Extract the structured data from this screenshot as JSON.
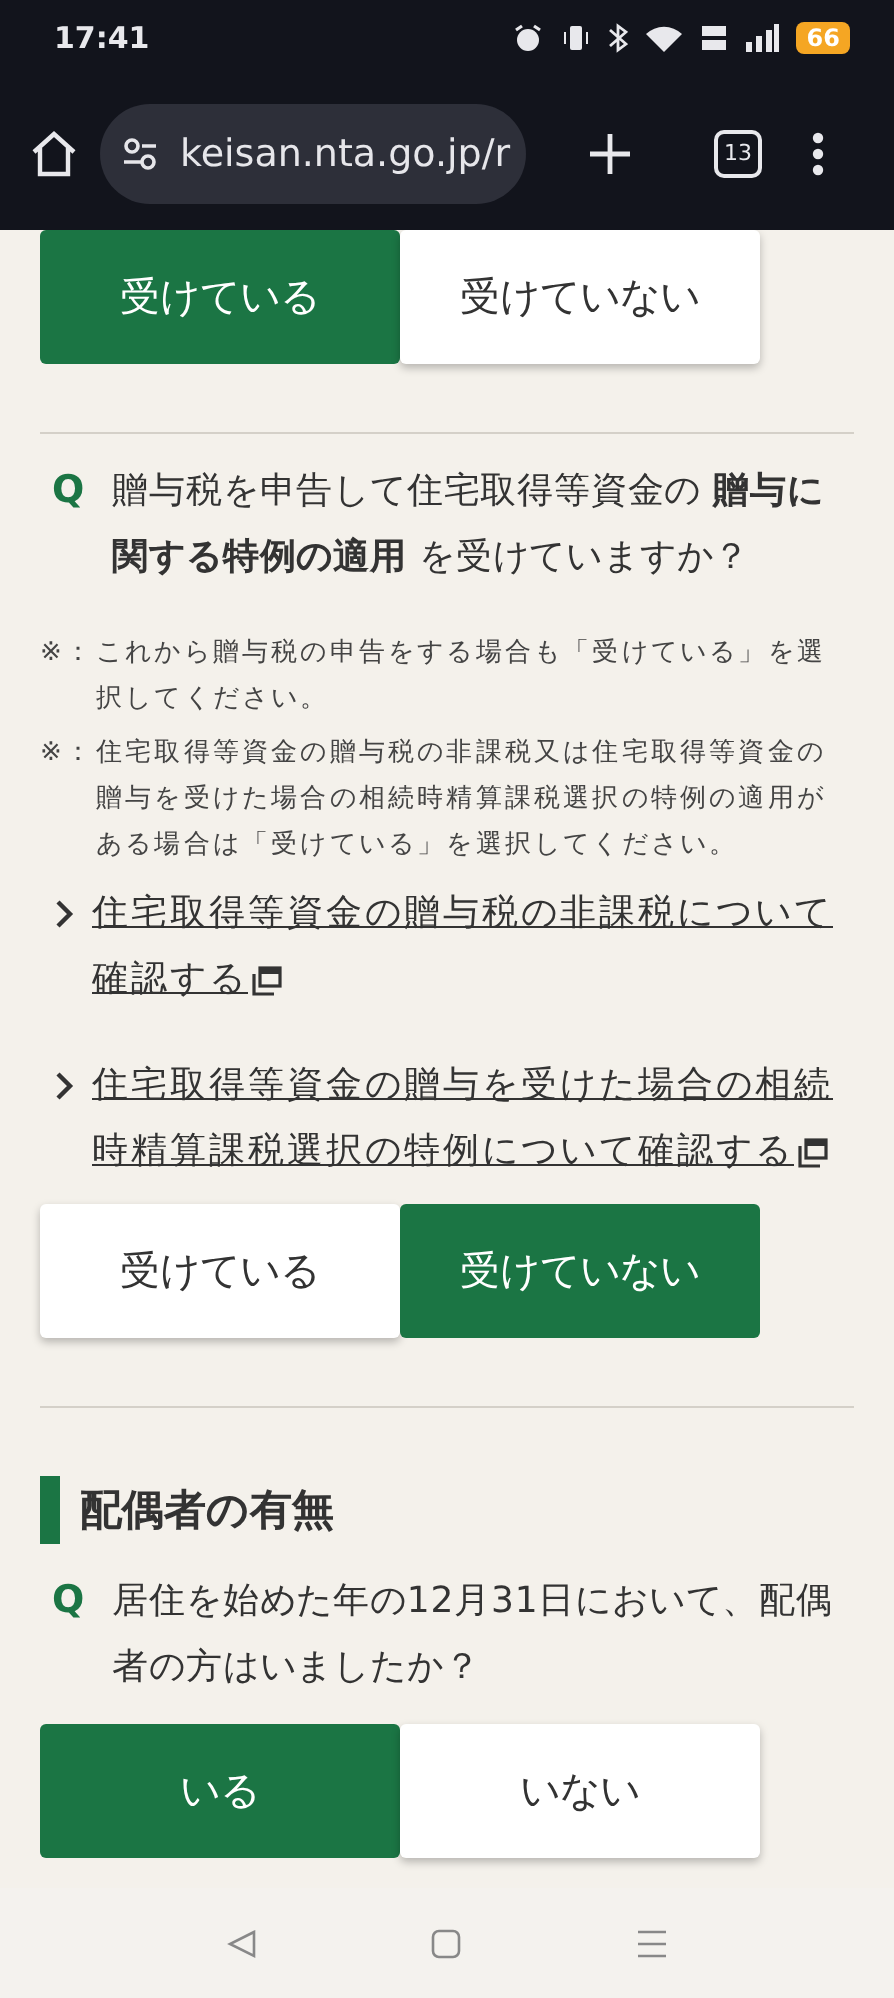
{
  "status_bar": {
    "time": "17:41",
    "battery": "66"
  },
  "browser": {
    "url": "keisan.nta.go.jp/r",
    "tab_count": "13"
  },
  "content": [
    {
      "kind": "choices",
      "options": [
        {
          "label": "受けている",
          "selected": true
        },
        {
          "label": "受けていない",
          "selected": false
        }
      ]
    },
    {
      "kind": "divider"
    },
    {
      "kind": "question",
      "mark": "Q",
      "text": "贈与税を申告して住宅取得等資金の **贈与に関する特例の適用** を受けていますか？"
    },
    {
      "kind": "note",
      "mark": "※：",
      "text": "これから贈与税の申告をする場合も「受けている」を選択してください。"
    },
    {
      "kind": "note",
      "mark": "※：",
      "text": "住宅取得等資金の贈与税の非課税又は住宅取得等資金の贈与を受けた場合の相続時精算課税選択の特例の適用がある場合は「受けている」を選択してください。"
    },
    {
      "kind": "link",
      "text": "住宅取得等資金の贈与税の非課税について確認する"
    },
    {
      "kind": "link",
      "text": "住宅取得等資金の贈与を受けた場合の相続時精算課税選択の特例について確認する"
    },
    {
      "kind": "choices",
      "options": [
        {
          "label": "受けている",
          "selected": false
        },
        {
          "label": "受けていない",
          "selected": true
        }
      ]
    },
    {
      "kind": "divider"
    },
    {
      "kind": "heading",
      "text": "配偶者の有無"
    },
    {
      "kind": "question",
      "mark": "Q",
      "text": "居住を始めた年の12月31日において、配偶者の方はいましたか？"
    },
    {
      "kind": "choices",
      "options": [
        {
          "label": "いる",
          "selected": true
        },
        {
          "label": "いない",
          "selected": false
        }
      ]
    }
  ]
}
